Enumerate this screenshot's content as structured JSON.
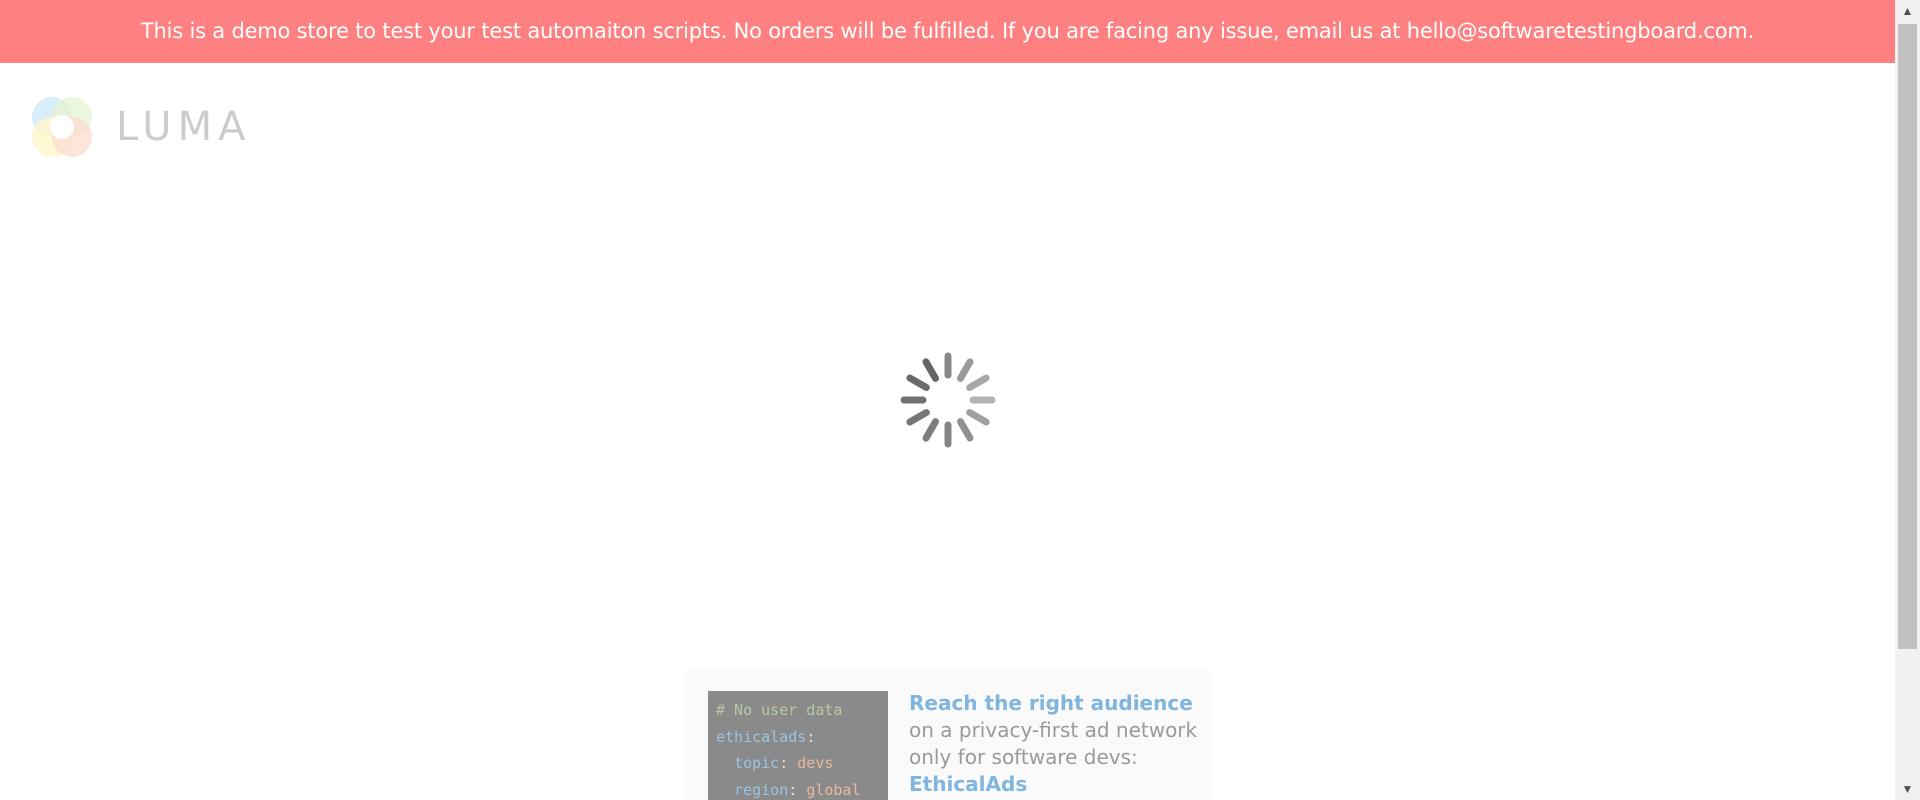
{
  "notice": {
    "text": "This is a demo store to test your test automaiton scripts. No orders will be fulfilled. If you are facing any issue, email us at hello@softwaretestingboard.com."
  },
  "logo": {
    "text": "LUMA",
    "colors": [
      "#55b4e6",
      "#a6d568",
      "#ffe14a",
      "#f28c5b"
    ]
  },
  "loader": {
    "icon": "spinner-icon"
  },
  "ad": {
    "code_lines": [
      {
        "comment": "# No user data"
      },
      {
        "key": "ethicalads",
        "sep": ":"
      },
      {
        "key": "topic",
        "sep": ": ",
        "value": "devs"
      },
      {
        "key": "region",
        "sep": ": ",
        "value": "global"
      }
    ],
    "headline": "Reach the right audience",
    "body": " on a privacy-first ad network only for software devs: ",
    "brand": "EthicalAds"
  },
  "colors": {
    "notice_bg": "#ff8080",
    "accent_link": "#7fb5de"
  }
}
